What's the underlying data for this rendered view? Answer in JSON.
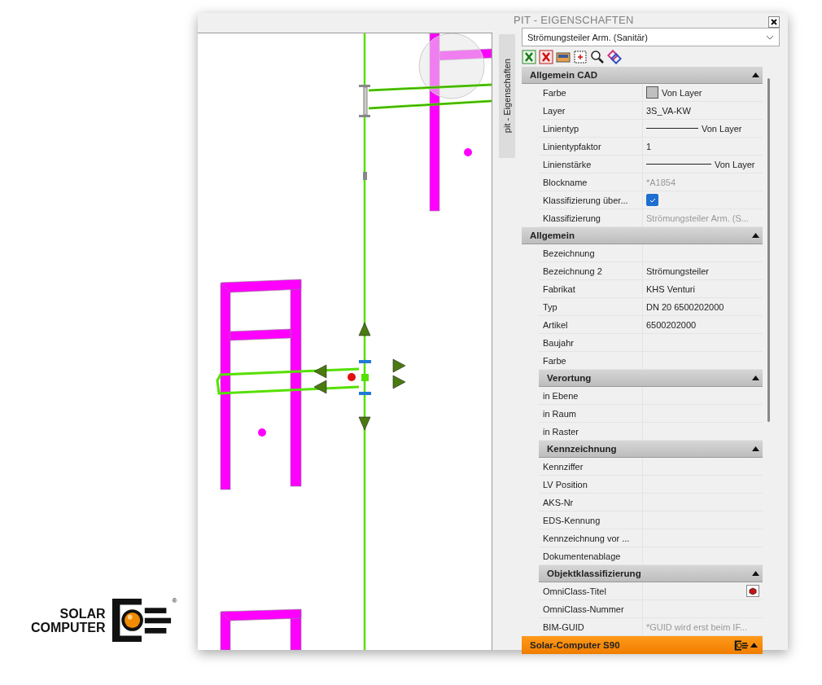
{
  "logo": {
    "lines": [
      "SOLAR",
      "COMPUTER"
    ],
    "mark": "®"
  },
  "panel": {
    "title": "PIT - EIGENSCHAFTEN",
    "side_tab": "pit - Eigenschaften",
    "dropdown": {
      "value": "Strömungsteiler Arm. (Sanitär)"
    },
    "sections": [
      {
        "title": "Allgemein CAD",
        "expanded": true,
        "rows": [
          {
            "label": "Farbe",
            "value": "Von Layer",
            "kind": "swatch",
            "disabled": false
          },
          {
            "label": "Layer",
            "value": "3S_VA-KW",
            "kind": "text",
            "disabled": false
          },
          {
            "label": "Linientyp",
            "value": "Von Layer",
            "kind": "line",
            "disabled": false
          },
          {
            "label": "Linientypfaktor",
            "value": "1",
            "kind": "text",
            "disabled": false
          },
          {
            "label": "Linienstärke",
            "value": "Von Layer",
            "kind": "line",
            "disabled": false
          },
          {
            "label": "Blockname",
            "value": "*A1854",
            "kind": "text",
            "disabled": true
          },
          {
            "label": "Klassifizierung über...",
            "kind": "checkbox",
            "checked": true,
            "disabled": false
          },
          {
            "label": "Klassifizierung",
            "value": "Strömungsteiler Arm. (S...",
            "kind": "text",
            "disabled": true
          }
        ]
      },
      {
        "title": "Allgemein",
        "expanded": true,
        "rows": [
          {
            "label": "Bezeichnung",
            "kind": "text",
            "disabled": false
          },
          {
            "label": "Bezeichnung 2",
            "value": "Strömungsteiler",
            "kind": "text",
            "disabled": false
          },
          {
            "label": "Fabrikat",
            "value": "KHS Venturi",
            "kind": "text",
            "disabled": false
          },
          {
            "label": "Typ",
            "value": "DN 20 6500202000",
            "kind": "text",
            "disabled": false
          },
          {
            "label": "Artikel",
            "value": "6500202000",
            "kind": "text",
            "disabled": false
          },
          {
            "label": "Baujahr",
            "kind": "text",
            "disabled": false
          },
          {
            "label": "Farbe",
            "kind": "text",
            "disabled": false
          }
        ],
        "children": [
          {
            "title": "Verortung",
            "expanded": true,
            "rows": [
              {
                "label": "in Ebene",
                "kind": "text",
                "disabled": false
              },
              {
                "label": "in Raum",
                "kind": "text",
                "disabled": false
              },
              {
                "label": "in Raster",
                "kind": "text",
                "disabled": false
              }
            ]
          },
          {
            "title": "Kennzeichnung",
            "expanded": true,
            "rows": [
              {
                "label": "Kennziffer",
                "kind": "text",
                "disabled": false
              },
              {
                "label": "LV Position",
                "kind": "text",
                "disabled": false
              },
              {
                "label": "AKS-Nr",
                "kind": "text",
                "disabled": false
              },
              {
                "label": "EDS-Kennung",
                "kind": "text",
                "disabled": false
              },
              {
                "label": "Kennzeichnung vor ...",
                "kind": "text",
                "disabled": false
              },
              {
                "label": "Dokumentenablage",
                "kind": "text",
                "disabled": false
              }
            ]
          },
          {
            "title": "Objektklassifizierung",
            "expanded": true,
            "rows": [
              {
                "label": "OmniClass-Titel",
                "kind": "button",
                "disabled": false
              },
              {
                "label": "OmniClass-Nummer",
                "kind": "text",
                "disabled": false
              },
              {
                "label": "BIM-GUID",
                "value": "*GUID wird erst beim IF...",
                "kind": "text",
                "disabled": true
              }
            ]
          }
        ]
      }
    ],
    "footer": {
      "title": "Solar-Computer S90",
      "expanded": true
    }
  }
}
